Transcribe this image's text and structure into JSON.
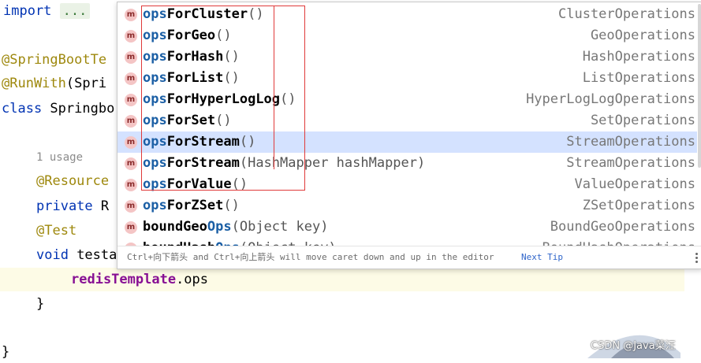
{
  "editor": {
    "lines": {
      "import_kw": "import",
      "import_fold": "...",
      "ann1": "@SpringBootTe",
      "ann2_at": "@RunWith",
      "ann2_rest": "(Spri",
      "class_kw": "class",
      "class_name": " Springbo",
      "usage_hint": "1 usage",
      "resource_ann": "@Resource",
      "private_kw": "private",
      "private_rest": " R",
      "test_ann": "@Test",
      "void_kw": "void",
      "void_rest": " testa",
      "current_field": "redisTemplate",
      "current_rest": ".ops",
      "close_brace_inner": "}",
      "close_brace_outer": "}"
    }
  },
  "completion": {
    "items": [
      {
        "prefix": "ops",
        "rest": "ForCluster",
        "params": "()",
        "type": "ClusterOperations",
        "icon": "m"
      },
      {
        "prefix": "ops",
        "rest": "ForGeo",
        "params": "()",
        "type": "GeoOperations",
        "icon": "m"
      },
      {
        "prefix": "ops",
        "rest": "ForHash",
        "params": "()",
        "type": "HashOperations",
        "icon": "m"
      },
      {
        "prefix": "ops",
        "rest": "ForList",
        "params": "()",
        "type": "ListOperations",
        "icon": "m"
      },
      {
        "prefix": "ops",
        "rest": "ForHyperLogLog",
        "params": "()",
        "type": "HyperLogLogOperations",
        "icon": "m"
      },
      {
        "prefix": "ops",
        "rest": "ForSet",
        "params": "()",
        "type": "SetOperations",
        "icon": "m"
      },
      {
        "prefix": "ops",
        "rest": "ForStream",
        "params": "()",
        "type": "StreamOperations",
        "icon": "m",
        "selected": true
      },
      {
        "prefix": "ops",
        "rest": "ForStream",
        "params": "(HashMapper hashMapper)",
        "type": "StreamOperations",
        "icon": "m"
      },
      {
        "prefix": "ops",
        "rest": "ForValue",
        "params": "()",
        "type": "ValueOperations",
        "icon": "m"
      },
      {
        "prefix": "ops",
        "rest": "ForZSet",
        "params": "()",
        "type": "ZSetOperations",
        "icon": "m"
      },
      {
        "before": "boundGeo",
        "prefix": "Ops",
        "rest": "",
        "params": "(Object key)",
        "type": "BoundGeoOperations",
        "icon": "m"
      },
      {
        "before": "boundHash",
        "prefix": "Ops",
        "rest": "",
        "params": "(Object key)",
        "type": "BoundHashOperations",
        "icon": "m"
      }
    ],
    "footer": {
      "tip": "Ctrl+向下箭头 and Ctrl+向上箭头 will move caret down and up in the editor",
      "next_tip": "Next Tip"
    }
  },
  "watermark": "CSDN @Java菜汪",
  "colors": {
    "selection": "#d4e2ff",
    "match": "#1b5fa5",
    "annotation_box": "#e03a3a",
    "method_icon_bg": "#f4c5c5"
  }
}
